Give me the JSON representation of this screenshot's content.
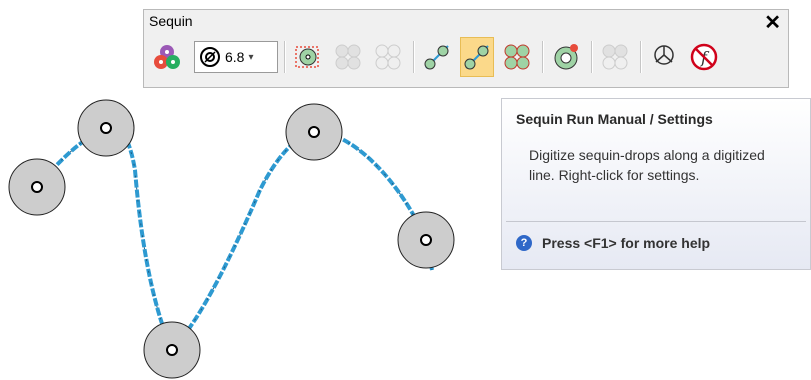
{
  "toolbar": {
    "title": "Sequin",
    "close_glyph": "✕",
    "size_value": "6.8",
    "dropdown_glyph": "▾",
    "buttons": [
      {
        "icon": "sequin-colors-icon"
      },
      {
        "icon": "sequin-size-icon"
      },
      {
        "icon": "sequin-placement-icon"
      },
      {
        "icon": "sequin-auto-fill-icon"
      },
      {
        "icon": "sequin-grid-icon"
      },
      {
        "icon": "sequin-run-auto-icon"
      },
      {
        "icon": "sequin-run-manual-icon",
        "active": true
      },
      {
        "icon": "sequin-overlap-icon"
      },
      {
        "icon": "sequin-single-icon"
      },
      {
        "icon": "sequin-double-icon"
      },
      {
        "icon": "sequin-attach-icon"
      },
      {
        "icon": "no-sequin-icon"
      }
    ]
  },
  "tooltip": {
    "title": "Sequin Run Manual / Settings",
    "body": "Digitize sequin-drops along a digitized line. Right-click for settings.",
    "help_text": "Press <F1> for more help",
    "help_glyph": "?"
  },
  "colors": {
    "thread": "#2e9ad1",
    "sequin_fill": "#cdcdcd",
    "active_button": "#fbd98a"
  }
}
